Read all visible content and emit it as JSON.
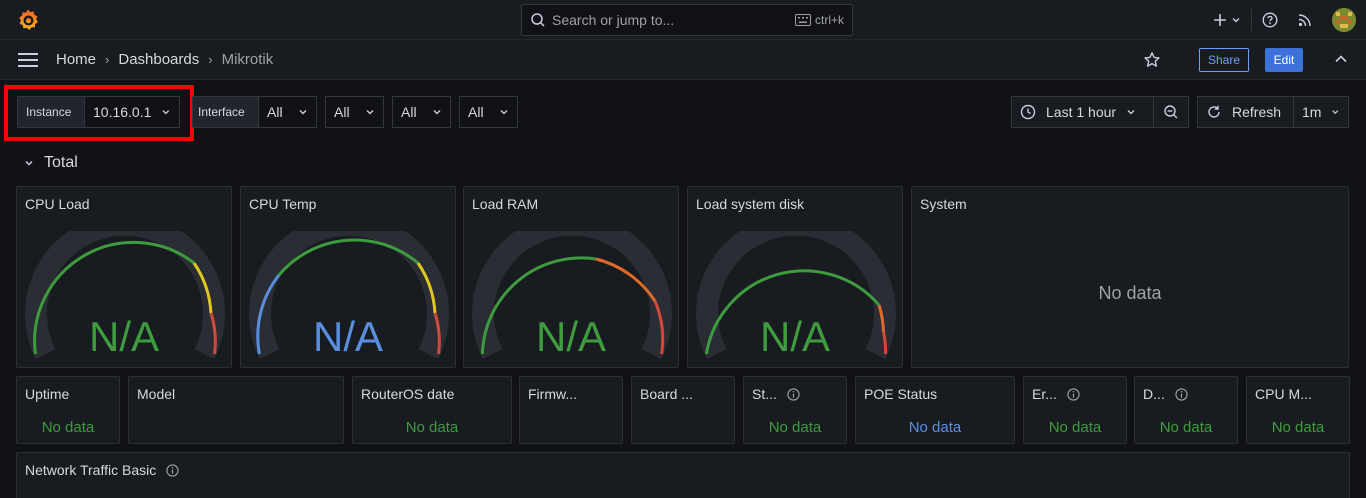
{
  "search": {
    "placeholder": "Search or jump to...",
    "shortcut": "ctrl+k"
  },
  "breadcrumb": {
    "home": "Home",
    "dashboards": "Dashboards",
    "current": "Mikrotik"
  },
  "toolbar": {
    "share": "Share",
    "edit": "Edit",
    "time_range": "Last 1 hour",
    "refresh": "Refresh",
    "refresh_interval": "1m"
  },
  "variables": {
    "instance_label": "Instance",
    "instance_value": "10.16.0.1",
    "interface_label": "Interface",
    "interface_value": "All",
    "var3_value": "All",
    "var4_value": "All",
    "var5_value": "All"
  },
  "row": {
    "title": "Total"
  },
  "gauges": [
    {
      "title": "CPU Load",
      "value": "N/A",
      "value_color": "#3e9c3e"
    },
    {
      "title": "CPU Temp",
      "value": "N/A",
      "value_color": "#5a8fe0"
    },
    {
      "title": "Load RAM",
      "value": "N/A",
      "value_color": "#3e9c3e"
    },
    {
      "title": "Load system disk",
      "value": "N/A",
      "value_color": "#3e9c3e"
    }
  ],
  "system_panel": {
    "title": "System",
    "value": "No data"
  },
  "stat_panels": [
    {
      "title": "Uptime",
      "value": "No data"
    },
    {
      "title": "Model",
      "value": ""
    },
    {
      "title": "RouterOS date",
      "value": "No data"
    },
    {
      "title": "Firmw...",
      "value": ""
    },
    {
      "title": "Board ...",
      "value": ""
    },
    {
      "title": "St...",
      "value": "No data"
    },
    {
      "title": "POE Status",
      "value": "No data"
    },
    {
      "title": "Er...",
      "value": "No data"
    },
    {
      "title": "D...",
      "value": "No data"
    },
    {
      "title": "CPU M...",
      "value": "No data"
    }
  ],
  "traffic_panel": {
    "title": "Network Traffic Basic"
  },
  "colors": {
    "green": "#3e9c3e",
    "blue": "#5a8fe0",
    "yellow": "#e0c420",
    "red": "#d44a3a",
    "orange": "#e06a2a",
    "accent": "#3d71d9"
  }
}
